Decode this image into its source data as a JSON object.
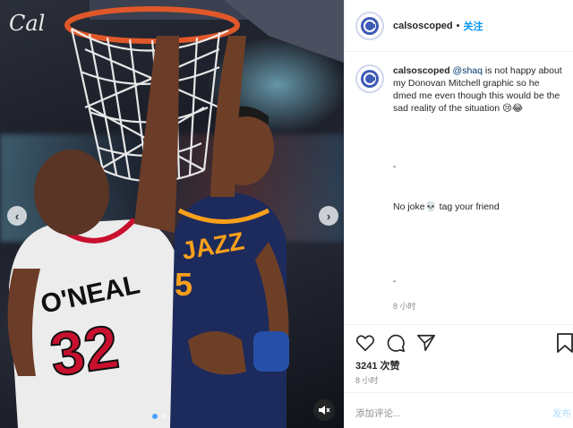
{
  "post": {
    "username": "calsoscoped",
    "follow_separator": "•",
    "follow_label": "关注",
    "caption_mention": "@shaq",
    "caption_body": " is not happy about my Donovan Mitchell graphic so he dmed me even though this would be the sad reality of the situation 😢😂",
    "line_dash1": "-",
    "line_joke": "No joke💀 tag your friend",
    "line_dash2": "-",
    "caption_time": "8 小时",
    "likes": "3241 次赞",
    "post_time": "8 小时",
    "comment_placeholder": "添加评论...",
    "post_label": "发布"
  },
  "photo": {
    "signature": "Cal",
    "jersey_name": "O'NEAL",
    "jersey_number": "32",
    "opponent_team": "JAZZ",
    "opponent_number": "5"
  },
  "icons": {
    "prev": "chevron-left-icon",
    "next": "chevron-right-icon",
    "mute": "speaker-muted-icon",
    "like": "heart-icon",
    "comment": "comment-icon",
    "share": "send-icon",
    "save": "bookmark-icon"
  },
  "colors": {
    "accent": "#0095f6",
    "text": "#262626",
    "muted": "#8e8e8e",
    "heat_red": "#c8102e",
    "jazz_navy": "#1d2a5c",
    "jazz_gold": "#f9a01b"
  }
}
